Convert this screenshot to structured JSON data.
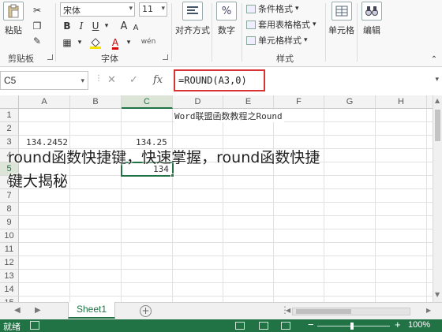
{
  "ribbon": {
    "clipboard": {
      "paste_label": "粘贴",
      "group_label": "剪贴板"
    },
    "font": {
      "font_name": "宋体",
      "font_size": "11",
      "bold": "B",
      "italic": "I",
      "underline": "U",
      "grow": "A",
      "shrink": "A",
      "font_color_letter": "A",
      "wen": "wén",
      "group_label": "字体"
    },
    "alignment": {
      "label": "对齐方式"
    },
    "number": {
      "symbol": "%",
      "label": "数字"
    },
    "styles": {
      "conditional": "条件格式",
      "table_format": "套用表格格式",
      "cell_styles": "单元格样式",
      "group_label": "样式"
    },
    "cells": {
      "label": "单元格"
    },
    "editing": {
      "label": "编辑"
    }
  },
  "formula_bar": {
    "name_box": "C5",
    "cancel": "✕",
    "enter": "✓",
    "fx": "fx",
    "formula": "=ROUND(A3,0)"
  },
  "grid": {
    "columns": [
      "A",
      "B",
      "C",
      "D",
      "E",
      "F",
      "G",
      "H"
    ],
    "rows": [
      "1",
      "2",
      "3",
      "4",
      "5",
      "6",
      "7",
      "8",
      "9",
      "10",
      "11",
      "12",
      "13",
      "14",
      "15"
    ],
    "selected_column": "C",
    "selected_row": "5",
    "cells": {
      "d1": "Word联盟函数教程之Round",
      "a3": "134.2452",
      "c3": "134.25",
      "c5": "134"
    }
  },
  "sheets": {
    "tab": "Sheet1",
    "add": "+"
  },
  "status": {
    "ready": "就绪",
    "zoom": "100%",
    "minus": "−",
    "plus": "+"
  },
  "overlay": {
    "line1": "round函数快捷键，快速掌握，round函数快捷",
    "line2": "键大揭秘"
  },
  "colors": {
    "excel_green": "#217346",
    "formula_highlight": "#d93232"
  }
}
